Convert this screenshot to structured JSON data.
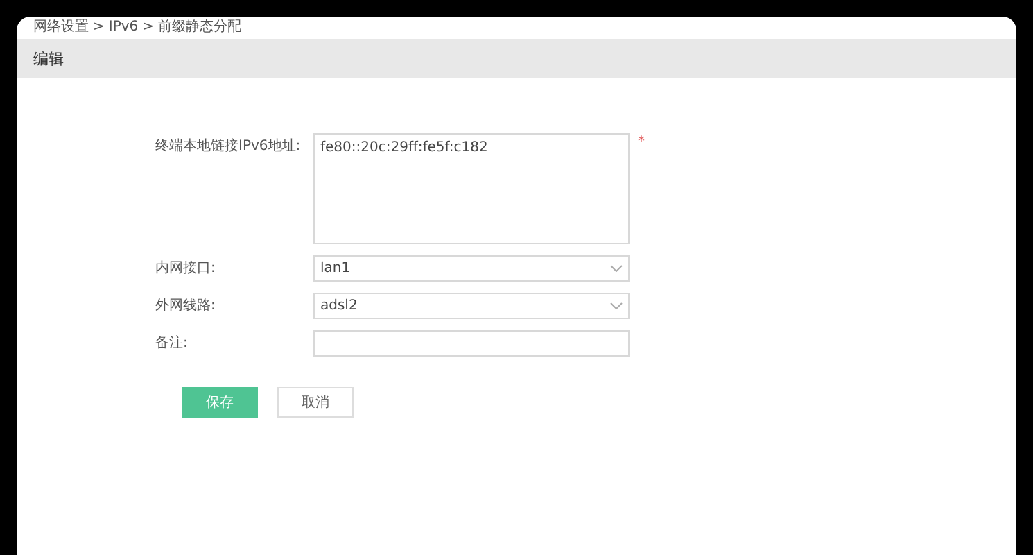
{
  "breadcrumb": [
    "网络设置",
    ">",
    "IPv6",
    ">",
    "前缀静态分配"
  ],
  "header": {
    "title": "编辑"
  },
  "fields": [
    {
      "kind": "textarea",
      "label": "终端本地链接IPv6地址:",
      "value": "fe80::20c:29ff:fe5f:c182",
      "required": true
    },
    {
      "kind": "select",
      "label": "内网接口:",
      "value": "lan1",
      "required": false
    },
    {
      "kind": "select",
      "label": "外网线路:",
      "value": "adsl2",
      "required": false
    },
    {
      "kind": "input",
      "label": "备注:",
      "required": false
    }
  ],
  "required_mark": "*",
  "buttons": [
    {
      "kind": "primary",
      "label": "保存"
    },
    {
      "kind": "secondary",
      "label": "取消"
    }
  ]
}
